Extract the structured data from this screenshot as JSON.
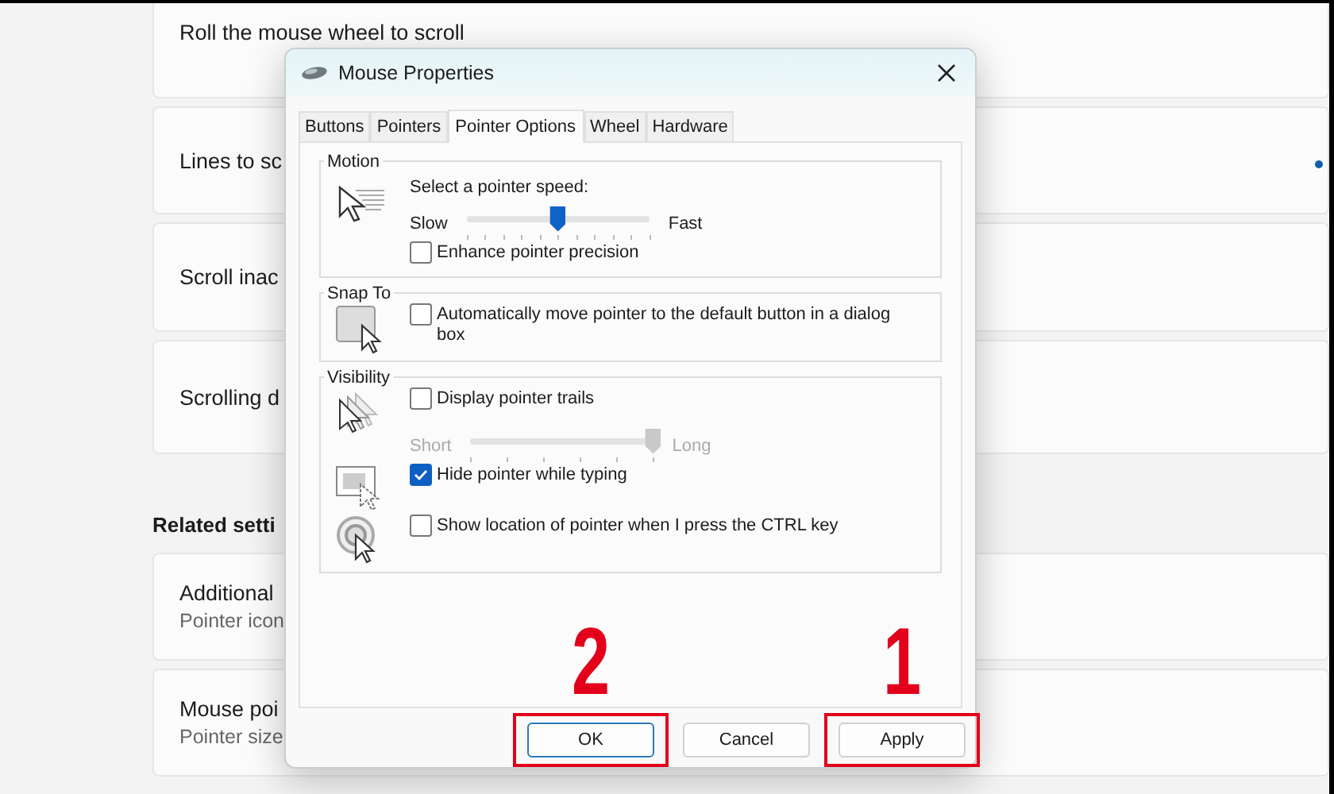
{
  "background": {
    "cards": [
      {
        "title": "Roll the mouse wheel to scroll",
        "thumb": false
      },
      {
        "title": "Lines to sc",
        "thumb": true
      },
      {
        "title": "Scroll inac",
        "thumb": false
      },
      {
        "title": "Scrolling d",
        "thumb": false
      }
    ],
    "section_heading": "Related setti",
    "related_cards": [
      {
        "title": "Additional",
        "subtitle": "Pointer icon"
      },
      {
        "title": "Mouse poi",
        "subtitle": "Pointer size"
      }
    ]
  },
  "dialog": {
    "title": "Mouse Properties",
    "tabs": [
      {
        "label": "Buttons",
        "selected": false
      },
      {
        "label": "Pointers",
        "selected": false
      },
      {
        "label": "Pointer Options",
        "selected": true
      },
      {
        "label": "Wheel",
        "selected": false
      },
      {
        "label": "Hardware",
        "selected": false
      }
    ],
    "groups": [
      {
        "title": "Motion",
        "rows": [
          {
            "kind": "speed",
            "caption": "Select a pointer speed:",
            "min_label": "Slow",
            "max_label": "Fast",
            "level": 0.5,
            "disabled": false
          },
          {
            "kind": "checkbox",
            "label": "Enhance pointer precision",
            "checked": false
          }
        ]
      },
      {
        "title": "Snap To",
        "rows": [
          {
            "kind": "checkbox",
            "label": "Automatically move pointer to the default button in a dialog box",
            "checked": false
          }
        ]
      },
      {
        "title": "Visibility",
        "rows": [
          {
            "kind": "checkbox",
            "label": "Display pointer trails",
            "checked": false
          },
          {
            "kind": "slider",
            "min_label": "Short",
            "max_label": "Long",
            "level": 1,
            "disabled": true
          },
          {
            "kind": "checkbox",
            "label": "Hide pointer while typing",
            "checked": true
          },
          {
            "kind": "checkbox",
            "label": "Show location of pointer when I press the CTRL key",
            "checked": false
          }
        ]
      }
    ],
    "buttons": [
      {
        "label": "OK",
        "default": true,
        "highlighted": true,
        "callout": "2"
      },
      {
        "label": "Cancel",
        "default": false,
        "highlighted": false
      },
      {
        "label": "Apply",
        "default": false,
        "highlighted": true,
        "callout": "1"
      }
    ]
  }
}
